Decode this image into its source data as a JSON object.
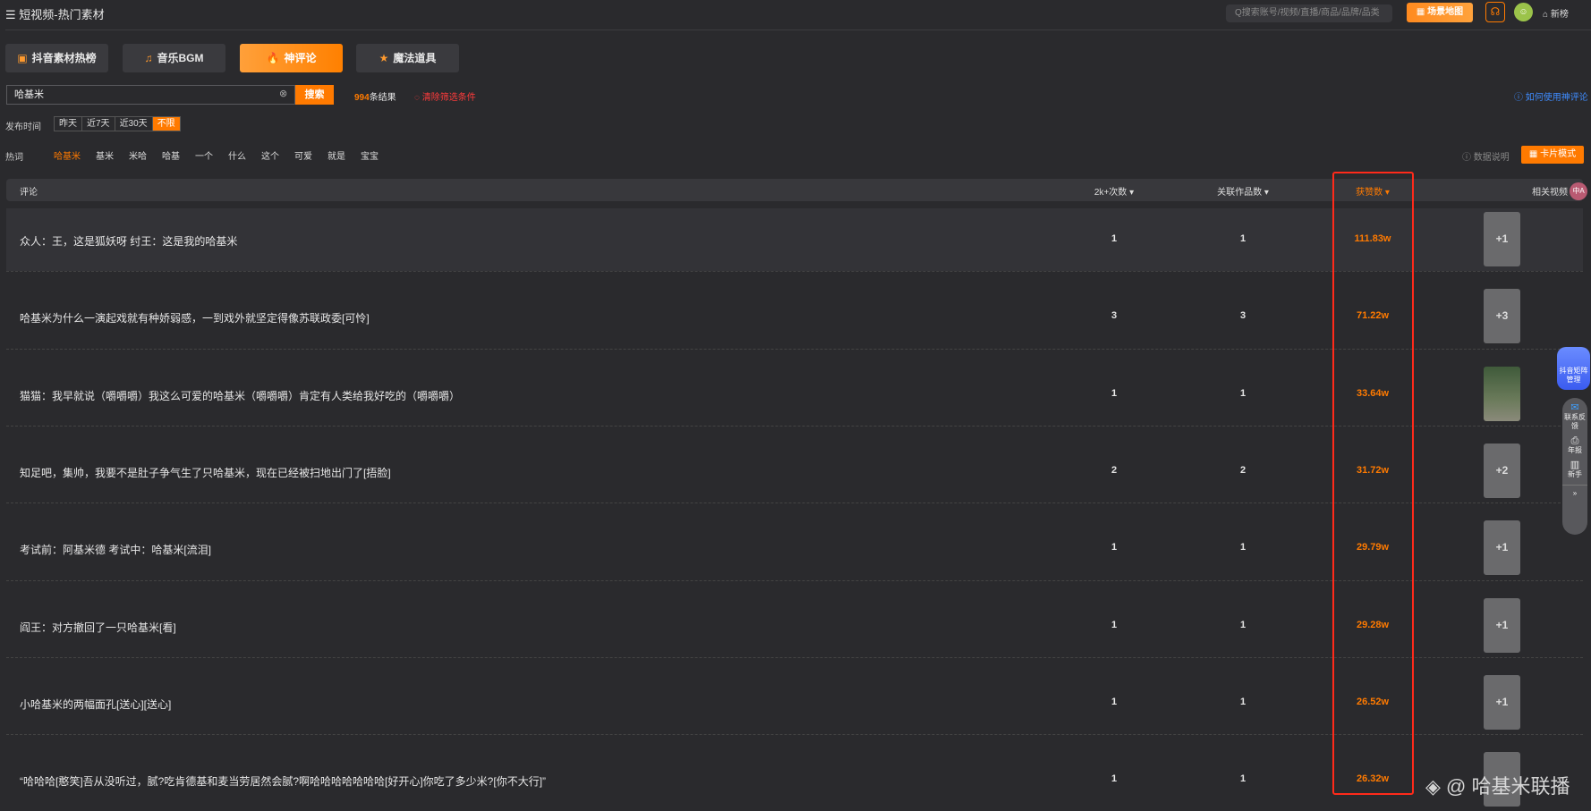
{
  "header": {
    "title": "短视频-热门素材",
    "search_placeholder": "Q搜索账号/视频/直播/商品/品牌/品类",
    "map_button": "场景地图",
    "home_label": "新榜"
  },
  "tabs": [
    {
      "label": "抖音素材热榜",
      "icon": "▣"
    },
    {
      "label": "音乐BGM",
      "icon": "♫"
    },
    {
      "label": "神评论",
      "icon": "🔥"
    },
    {
      "label": "魔法道具",
      "icon": "★"
    }
  ],
  "search": {
    "value": "哈基米",
    "button": "搜索",
    "result_count": "994",
    "result_suffix": "条结果",
    "clear_filters": "清除筛选条件",
    "help": "如何使用神评论"
  },
  "filters": {
    "time_label": "发布时间",
    "time_options": [
      "昨天",
      "近7天",
      "近30天",
      "不限"
    ],
    "hot_label": "热词",
    "hot_words": [
      "哈基米",
      "基米",
      "米哈",
      "哈基",
      "一个",
      "什么",
      "这个",
      "可爱",
      "就是",
      "宝宝"
    ]
  },
  "tools": {
    "data_info": "数据说明",
    "card_mode": "卡片模式"
  },
  "table": {
    "headers": {
      "comment": "评论",
      "count2k": "2k+次数 ▾",
      "related": "关联作品数 ▾",
      "likes": "获赞数 ▾",
      "videos": "相关视频"
    },
    "rows": [
      {
        "comment": "众人：王，这是狐妖呀 纣王：这是我的哈基米",
        "count2k": "1",
        "related": "1",
        "likes": "111.83w",
        "thumb": "+1"
      },
      {
        "comment": "哈基米为什么一演起戏就有种娇弱感，一到戏外就坚定得像苏联政委[可怜]",
        "count2k": "3",
        "related": "3",
        "likes": "71.22w",
        "thumb": "+3"
      },
      {
        "comment": "猫猫：我早就说（嚼嚼嚼）我这么可爱的哈基米（嚼嚼嚼）肯定有人类给我好吃的（嚼嚼嚼）",
        "count2k": "1",
        "related": "1",
        "likes": "33.64w",
        "thumb": ""
      },
      {
        "comment": "知足吧，集帅，我要不是肚子争气生了只哈基米，现在已经被扫地出门了[捂脸]",
        "count2k": "2",
        "related": "2",
        "likes": "31.72w",
        "thumb": "+2"
      },
      {
        "comment": "考试前：阿基米德 考试中：哈基米[流泪]",
        "count2k": "1",
        "related": "1",
        "likes": "29.79w",
        "thumb": "+1"
      },
      {
        "comment": "阎王：对方撤回了一只哈基米[看]",
        "count2k": "1",
        "related": "1",
        "likes": "29.28w",
        "thumb": "+1"
      },
      {
        "comment": "小哈基米的两幅面孔[送心][送心]",
        "count2k": "1",
        "related": "1",
        "likes": "26.52w",
        "thumb": "+1"
      },
      {
        "comment": "“哈哈哈[憨笑]吾从没听过，腻?吃肯德基和麦当劳居然会腻?啊哈哈哈哈哈哈哈[好开心]你吃了多少米?[你不大行]”",
        "count2k": "1",
        "related": "1",
        "likes": "26.32w",
        "thumb": ""
      }
    ]
  },
  "float": {
    "badge": "抖音矩阵管理",
    "items": [
      "联系反馈",
      "年报",
      "新手",
      "»"
    ]
  },
  "translate_icon": "中A",
  "watermark": "@ 哈基米联播",
  "colors": {
    "accent": "#ff7a00",
    "highlight_box": "#ff2a1a",
    "link": "#3f8cff"
  }
}
